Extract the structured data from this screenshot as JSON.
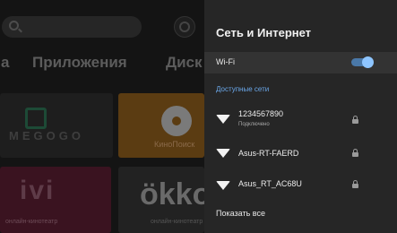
{
  "launcher": {
    "nav_tabs": [
      {
        "label": "а"
      },
      {
        "label": "Приложения"
      },
      {
        "label": "Диск"
      }
    ],
    "tiles": {
      "megogo": "MEGOGO",
      "kinopoisk": "КиноПоиск",
      "ivi_logo": "ivi",
      "ivi_sub": "онлайн-кинотеатр",
      "okko_logo": "ökko",
      "okko_sub": "онлайн-кинотеатр"
    }
  },
  "panel": {
    "title": "Сеть и Интернет",
    "wifi": {
      "label": "Wi-Fi",
      "enabled": true
    },
    "section_label": "Доступные сети",
    "networks": [
      {
        "ssid": "1234567890",
        "status": "Подключено",
        "secured": true
      },
      {
        "ssid": "Asus-RT-FAERD",
        "status": "",
        "secured": true
      },
      {
        "ssid": "Asus_RT_AC68U",
        "status": "",
        "secured": true
      }
    ],
    "show_all": "Показать все"
  },
  "colors": {
    "panel_bg": "#262626",
    "accent": "#6ba8ea",
    "toggle_knob": "#8ec5ff"
  }
}
